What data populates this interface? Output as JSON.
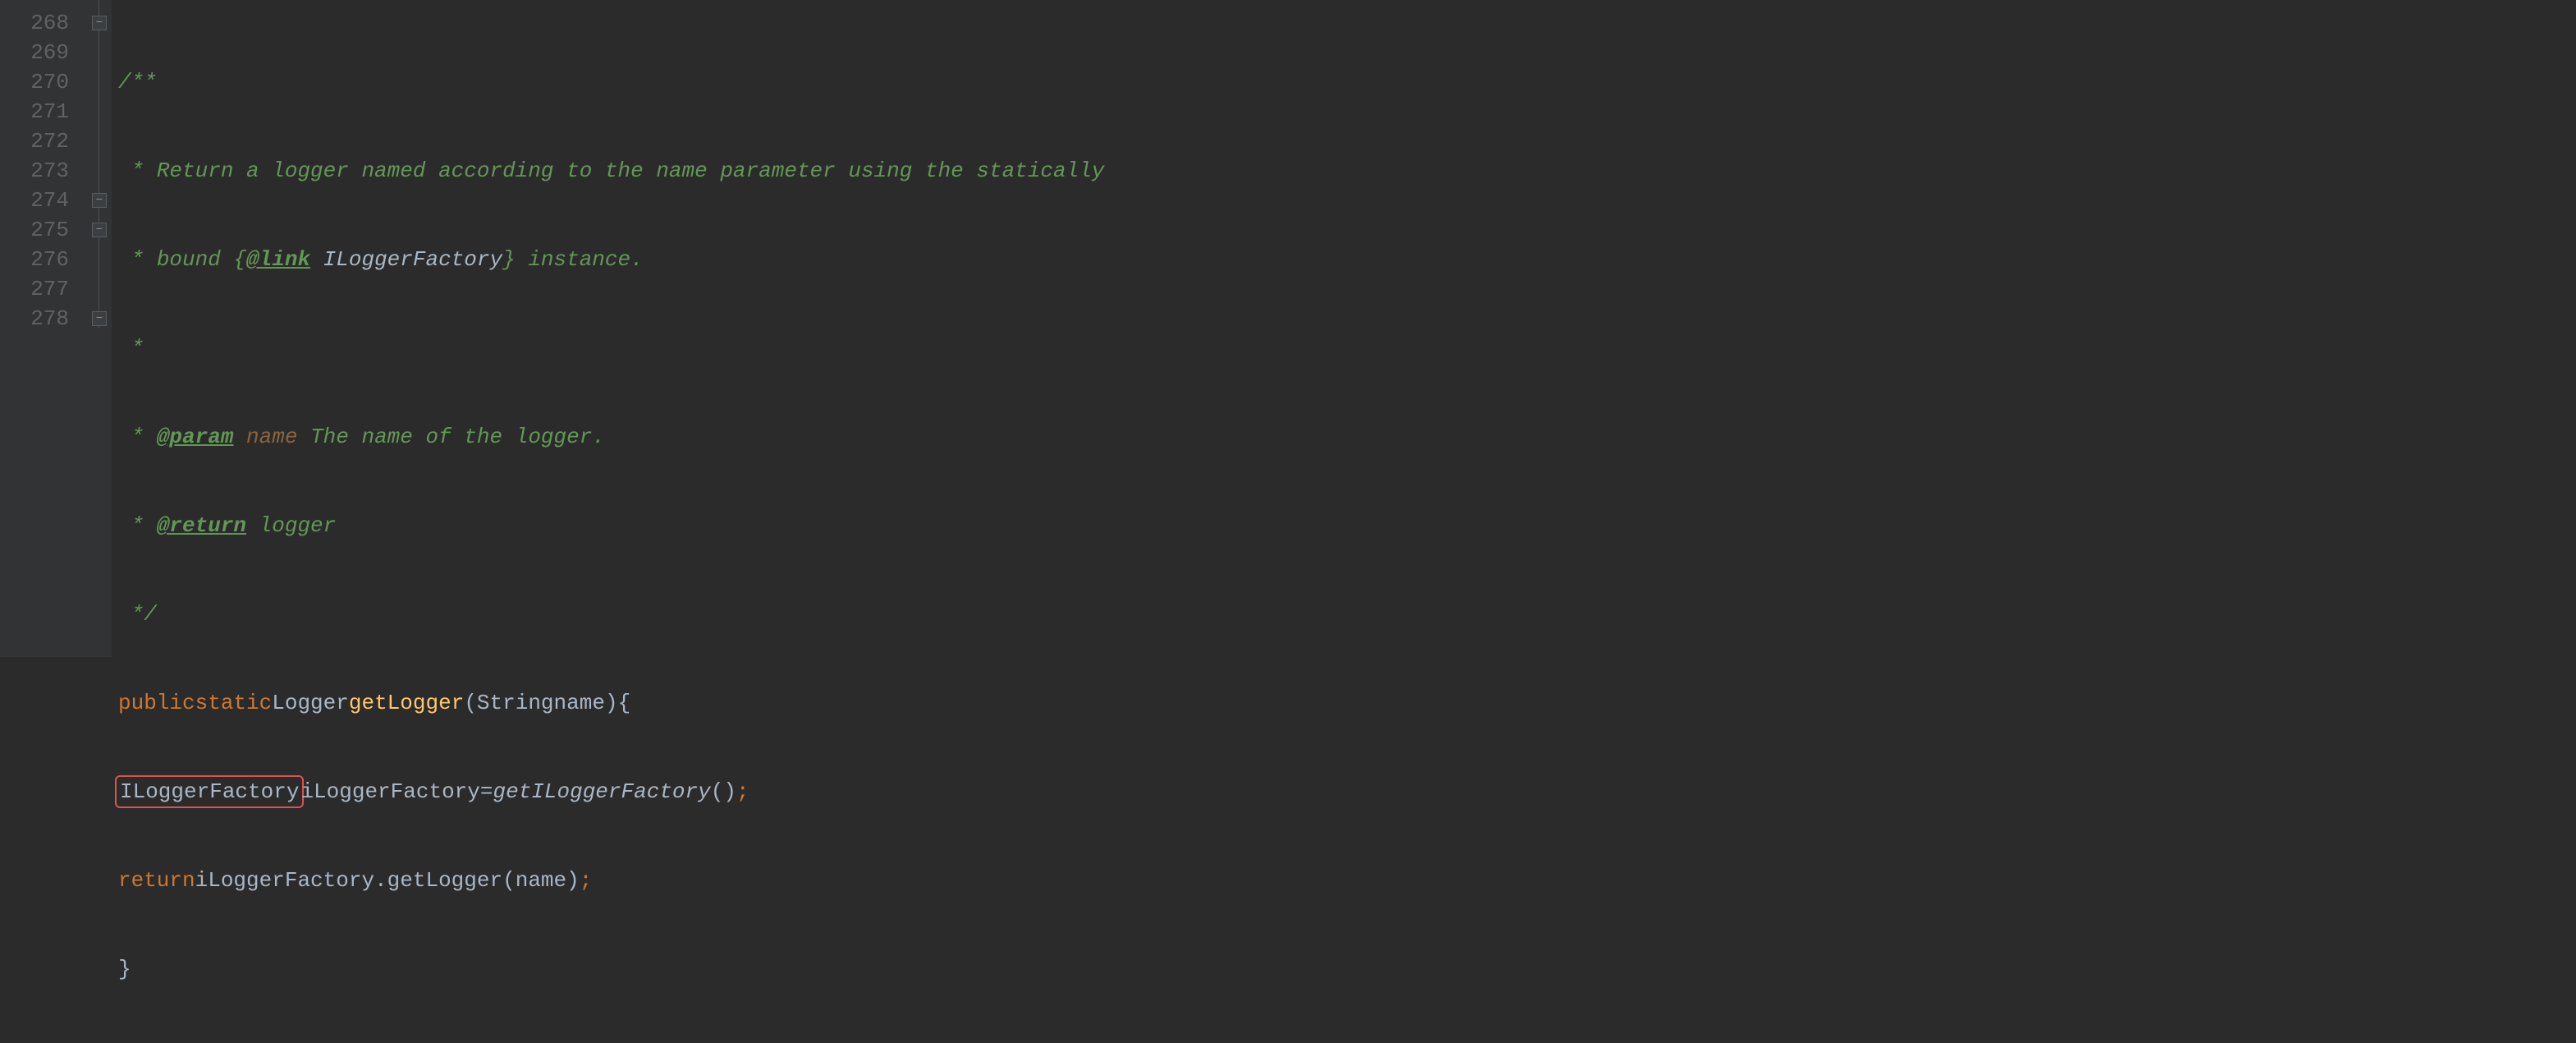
{
  "lines": {
    "l268": "268",
    "l269": "269",
    "l270": "270",
    "l271": "271",
    "l272": "272",
    "l273": "273",
    "l274": "274",
    "l275": "275",
    "l276": "276",
    "l277": "277",
    "l278": "278"
  },
  "code": {
    "c268_open": "/**",
    "c269_star": " * ",
    "c269_text": "Return a logger named according to the name parameter using the statically",
    "c270_star": " * ",
    "c270_text1": "bound {",
    "c270_link": "@link",
    "c270_space": " ",
    "c270_type": "ILoggerFactory",
    "c270_text2": "} instance.",
    "c271_star": " *",
    "c272_star": " * ",
    "c272_tag": "@param",
    "c272_space": " ",
    "c272_name": "name",
    "c272_desc": " The name of the logger.",
    "c273_star": " * ",
    "c273_tag": "@return",
    "c273_desc": " logger",
    "c274_close": " */",
    "c275_public": "public",
    "c275_static": "static",
    "c275_type": "Logger",
    "c275_method": "getLogger",
    "c275_paren_open": "(",
    "c275_param_type": "String",
    "c275_param_name": "name",
    "c275_paren_close": ")",
    "c275_brace": "{",
    "c276_type": "ILoggerFactory",
    "c276_var": "iLoggerFactory",
    "c276_eq": "=",
    "c276_call": "getILoggerFactory",
    "c276_parens": "()",
    "c276_semi": ";",
    "c277_return": "return",
    "c277_var": "iLoggerFactory",
    "c277_dot": ".",
    "c277_method": "getLogger",
    "c277_paren_open": "(",
    "c277_arg": "name",
    "c277_paren_close": ")",
    "c277_semi": ";",
    "c278_brace": "}"
  },
  "fold": {
    "minus": "−"
  }
}
